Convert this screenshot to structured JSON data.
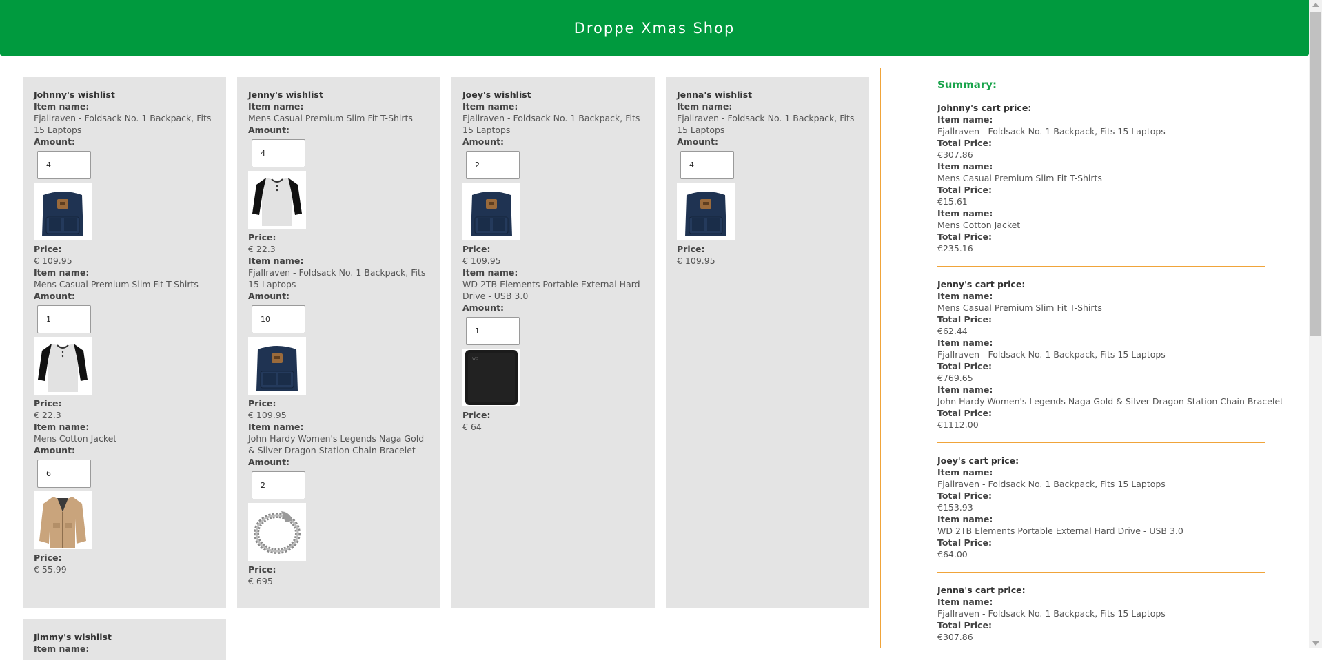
{
  "header": {
    "title": "Droppe Xmas Shop"
  },
  "labels": {
    "item_name": "Item name:",
    "amount": "Amount:",
    "price": "Price:",
    "total_price": "Total Price:"
  },
  "wishlists": [
    {
      "title": "Johnny's wishlist",
      "items": [
        {
          "name": "Fjallraven - Foldsack No. 1 Backpack, Fits 15 Laptops",
          "amount": "4",
          "price": "€ 109.95",
          "image": "backpack"
        },
        {
          "name": "Mens Casual Premium Slim Fit T-Shirts",
          "amount": "1",
          "price": "€ 22.3",
          "image": "tshirt"
        },
        {
          "name": "Mens Cotton Jacket",
          "amount": "6",
          "price": "€ 55.99",
          "image": "jacket"
        }
      ]
    },
    {
      "title": "Jenny's wishlist",
      "items": [
        {
          "name": "Mens Casual Premium Slim Fit T-Shirts",
          "amount": "4",
          "price": "€ 22.3",
          "image": "tshirt"
        },
        {
          "name": "Fjallraven - Foldsack No. 1 Backpack, Fits 15 Laptops",
          "amount": "10",
          "price": "€ 109.95",
          "image": "backpack"
        },
        {
          "name": "John Hardy Women's Legends Naga Gold & Silver Dragon Station Chain Bracelet",
          "amount": "2",
          "price": "€ 695",
          "image": "bracelet"
        }
      ]
    },
    {
      "title": "Joey's wishlist",
      "items": [
        {
          "name": "Fjallraven - Foldsack No. 1 Backpack, Fits 15 Laptops",
          "amount": "2",
          "price": "€ 109.95",
          "image": "backpack"
        },
        {
          "name": "WD 2TB Elements Portable External Hard Drive - USB 3.0",
          "amount": "1",
          "price": "€ 64",
          "image": "harddrive"
        }
      ]
    },
    {
      "title": "Jenna's wishlist",
      "items": [
        {
          "name": "Fjallraven - Foldsack No. 1 Backpack, Fits 15 Laptops",
          "amount": "4",
          "price": "€ 109.95",
          "image": "backpack"
        }
      ]
    },
    {
      "title": "Jimmy's wishlist",
      "items": []
    }
  ],
  "summary": {
    "title": "Summary:",
    "carts": [
      {
        "title": "Johnny's cart price:",
        "items": [
          {
            "name": "Fjallraven - Foldsack No. 1 Backpack, Fits 15 Laptops",
            "total": "€307.86"
          },
          {
            "name": "Mens Casual Premium Slim Fit T-Shirts",
            "total": "€15.61"
          },
          {
            "name": "Mens Cotton Jacket",
            "total": "€235.16"
          }
        ]
      },
      {
        "title": "Jenny's cart price:",
        "items": [
          {
            "name": "Mens Casual Premium Slim Fit T-Shirts",
            "total": "€62.44"
          },
          {
            "name": "Fjallraven - Foldsack No. 1 Backpack, Fits 15 Laptops",
            "total": "€769.65"
          },
          {
            "name": "John Hardy Women's Legends Naga Gold & Silver Dragon Station Chain Bracelet",
            "total": "€1112.00"
          }
        ]
      },
      {
        "title": "Joey's cart price:",
        "items": [
          {
            "name": "Fjallraven - Foldsack No. 1 Backpack, Fits 15 Laptops",
            "total": "€153.93"
          },
          {
            "name": "WD 2TB Elements Portable External Hard Drive - USB 3.0",
            "total": "€64.00"
          }
        ]
      },
      {
        "title": "Jenna's cart price:",
        "items": [
          {
            "name": "Fjallraven - Foldsack No. 1 Backpack, Fits 15 Laptops",
            "total": "€307.86"
          }
        ]
      }
    ]
  },
  "colors": {
    "header": "#009a3e",
    "card": "#e4e4e4",
    "divider": "#f0a43a",
    "summary_title": "#18a34a"
  }
}
